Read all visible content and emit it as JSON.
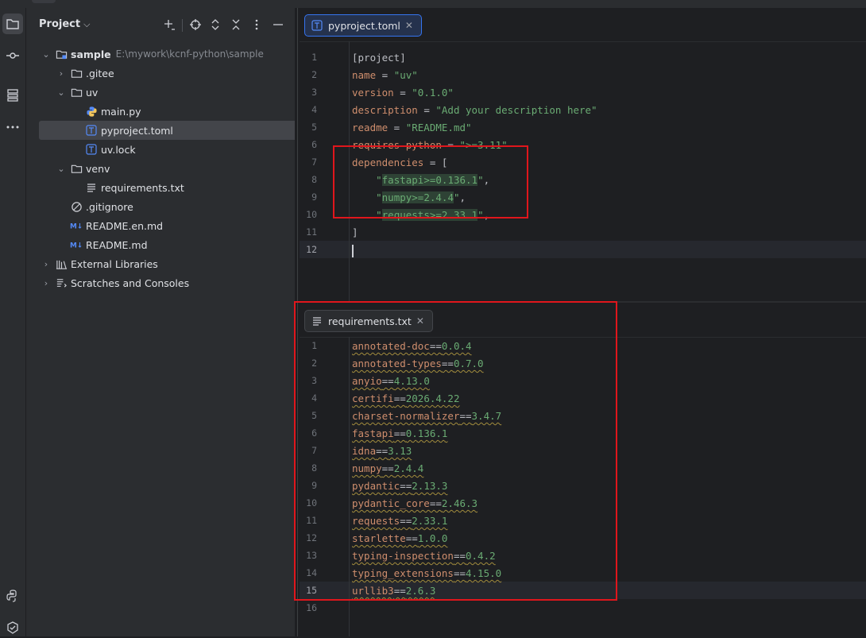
{
  "project_pane": {
    "title": "Project",
    "tree": [
      {
        "label": "sample",
        "path": "E:\\mywork\\kcnf-python\\sample",
        "level": 0,
        "arrow": "down",
        "icon": "module-folder-icon",
        "bold": true
      },
      {
        "label": ".gitee",
        "level": 1,
        "arrow": "right",
        "icon": "folder-icon"
      },
      {
        "label": "uv",
        "level": 1,
        "arrow": "down",
        "icon": "folder-icon"
      },
      {
        "label": "main.py",
        "level": 2,
        "arrow": "",
        "icon": "python-file-icon"
      },
      {
        "label": "pyproject.toml",
        "level": 2,
        "arrow": "",
        "icon": "toml-file-icon",
        "selected": true
      },
      {
        "label": "uv.lock",
        "level": 2,
        "arrow": "",
        "icon": "toml-file-icon"
      },
      {
        "label": "venv",
        "level": 1,
        "arrow": "down",
        "icon": "folder-icon"
      },
      {
        "label": "requirements.txt",
        "level": 2,
        "arrow": "",
        "icon": "text-file-icon"
      },
      {
        "label": ".gitignore",
        "level": 1,
        "arrow": "",
        "icon": "ignore-file-icon"
      },
      {
        "label": "README.en.md",
        "level": 1,
        "arrow": "",
        "icon": "markdown-file-icon"
      },
      {
        "label": "README.md",
        "level": 1,
        "arrow": "",
        "icon": "markdown-file-icon"
      },
      {
        "label": "External Libraries",
        "level": 0,
        "arrow": "right",
        "icon": "library-icon"
      },
      {
        "label": "Scratches and Consoles",
        "level": 0,
        "arrow": "right",
        "icon": "scratches-icon"
      }
    ]
  },
  "top_editor": {
    "tab_label": "pyproject.toml",
    "lines": [
      [
        {
          "t": "[project]"
        }
      ],
      [
        {
          "t": "name",
          "c": "kw"
        },
        {
          "t": " = "
        },
        {
          "t": "\"uv\"",
          "c": "str"
        }
      ],
      [
        {
          "t": "version",
          "c": "kw"
        },
        {
          "t": " = "
        },
        {
          "t": "\"0.1.0\"",
          "c": "str"
        }
      ],
      [
        {
          "t": "description",
          "c": "kw"
        },
        {
          "t": " = "
        },
        {
          "t": "\"Add your description here\"",
          "c": "str"
        }
      ],
      [
        {
          "t": "readme",
          "c": "kw"
        },
        {
          "t": " = "
        },
        {
          "t": "\"README.md\"",
          "c": "str"
        }
      ],
      [
        {
          "t": "requires-python",
          "c": "kw"
        },
        {
          "t": " = "
        },
        {
          "t": "\">=3.11\"",
          "c": "str"
        }
      ],
      [
        {
          "t": "dependencies",
          "c": "kw"
        },
        {
          "t": " = ["
        }
      ],
      [
        {
          "t": "    "
        },
        {
          "t": "\"",
          "c": "str"
        },
        {
          "t": "fastapi",
          "c": "str hl"
        },
        {
          "t": ">=",
          "c": "str hl"
        },
        {
          "t": "0.136.1",
          "c": "str hl"
        },
        {
          "t": "\"",
          "c": "str"
        },
        {
          "t": ","
        }
      ],
      [
        {
          "t": "    "
        },
        {
          "t": "\"",
          "c": "str"
        },
        {
          "t": "numpy",
          "c": "str hl"
        },
        {
          "t": ">=",
          "c": "str hl"
        },
        {
          "t": "2.4.4",
          "c": "str hl"
        },
        {
          "t": "\"",
          "c": "str"
        },
        {
          "t": ","
        }
      ],
      [
        {
          "t": "    "
        },
        {
          "t": "\"",
          "c": "str"
        },
        {
          "t": "requests",
          "c": "str hl"
        },
        {
          "t": ">=",
          "c": "str hl"
        },
        {
          "t": "2.33.1",
          "c": "str hl"
        },
        {
          "t": "\"",
          "c": "str"
        },
        {
          "t": ","
        }
      ],
      [
        {
          "t": "]"
        }
      ],
      []
    ]
  },
  "bottom_editor": {
    "tab_label": "requirements.txt",
    "lines": [
      [
        {
          "t": "annotated-doc",
          "c": "kw wavy"
        },
        {
          "t": "==",
          "c": "wavy"
        },
        {
          "t": "0.0.4",
          "c": "str wavy"
        }
      ],
      [
        {
          "t": "annotated-types",
          "c": "kw wavy"
        },
        {
          "t": "==",
          "c": "wavy"
        },
        {
          "t": "0.7.0",
          "c": "str wavy"
        }
      ],
      [
        {
          "t": "anyio",
          "c": "kw wavy"
        },
        {
          "t": "==",
          "c": "wavy"
        },
        {
          "t": "4.13.0",
          "c": "str wavy"
        }
      ],
      [
        {
          "t": "certifi",
          "c": "kw wavy"
        },
        {
          "t": "==",
          "c": "wavy"
        },
        {
          "t": "2026.4.22",
          "c": "str wavy"
        }
      ],
      [
        {
          "t": "charset-normalizer",
          "c": "kw wavy"
        },
        {
          "t": "==",
          "c": "wavy"
        },
        {
          "t": "3.4.7",
          "c": "str wavy"
        }
      ],
      [
        {
          "t": "fastapi",
          "c": "kw wavy"
        },
        {
          "t": "==",
          "c": "wavy"
        },
        {
          "t": "0.136.1",
          "c": "str wavy"
        }
      ],
      [
        {
          "t": "idna",
          "c": "kw wavy"
        },
        {
          "t": "==",
          "c": "wavy"
        },
        {
          "t": "3.13",
          "c": "str wavy"
        }
      ],
      [
        {
          "t": "numpy",
          "c": "kw wavy"
        },
        {
          "t": "==",
          "c": "wavy"
        },
        {
          "t": "2.4.4",
          "c": "str wavy"
        }
      ],
      [
        {
          "t": "pydantic",
          "c": "kw wavy"
        },
        {
          "t": "==",
          "c": "wavy"
        },
        {
          "t": "2.13.3",
          "c": "str wavy"
        }
      ],
      [
        {
          "t": "pydantic_core",
          "c": "kw wavy"
        },
        {
          "t": "==",
          "c": "wavy"
        },
        {
          "t": "2.46.3",
          "c": "str wavy"
        }
      ],
      [
        {
          "t": "requests",
          "c": "kw wavy"
        },
        {
          "t": "==",
          "c": "wavy"
        },
        {
          "t": "2.33.1",
          "c": "str wavy"
        }
      ],
      [
        {
          "t": "starlette",
          "c": "kw wavy"
        },
        {
          "t": "==",
          "c": "wavy"
        },
        {
          "t": "1.0.0",
          "c": "str wavy"
        }
      ],
      [
        {
          "t": "typing-inspection",
          "c": "kw wavy"
        },
        {
          "t": "==",
          "c": "wavy"
        },
        {
          "t": "0.4.2",
          "c": "str wavy"
        }
      ],
      [
        {
          "t": "typing_extensions",
          "c": "kw wavy"
        },
        {
          "t": "==",
          "c": "wavy"
        },
        {
          "t": "4.15.0",
          "c": "str wavy"
        }
      ],
      [
        {
          "t": "urllib3",
          "c": "kw wavy"
        },
        {
          "t": "==",
          "c": "wavy"
        },
        {
          "t": "2.6.3",
          "c": "str wavy"
        }
      ],
      []
    ]
  },
  "colors": {
    "accent": "#3574f0",
    "highlight_box": "#e0161c",
    "keyword": "#cf8e6d",
    "string": "#6aab73"
  }
}
